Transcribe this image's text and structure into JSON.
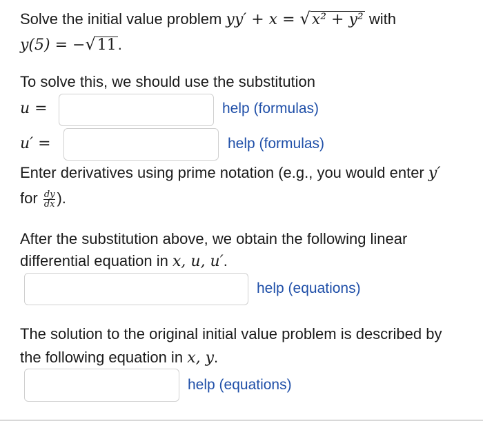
{
  "problem": {
    "intro": "Solve the initial value problem",
    "ode": "yy′ + x = ",
    "rad": "√",
    "radicand": "x² + y²",
    "with": "with",
    "ic_lhs": "y(5) = −",
    "ic_rad": "√",
    "ic_radicand": "11",
    "period": "."
  },
  "substitution": {
    "prompt": "To solve this, we should use the substitution",
    "u_label": "u =",
    "u_help": "help (formulas)",
    "uprime_label": "u′ =",
    "uprime_help": "help (formulas)",
    "note_a": "Enter derivatives using prime notation (e.g., you would enter",
    "note_y": "y′",
    "note_for": "for",
    "note_frac_num": "dy",
    "note_frac_den": "dx",
    "note_end": ")."
  },
  "linear": {
    "line1": "After the substitution above, we obtain the following linear",
    "line2": "differential equation in",
    "vars": "x, u, u′",
    "period": ".",
    "help": "help (equations)"
  },
  "solution": {
    "line1": "The solution to the original initial value problem is described by",
    "line2": "the following equation in",
    "vars": "x, y",
    "period": ".",
    "help": "help (equations)"
  },
  "inputs": {
    "u_value": "",
    "uprime_value": "",
    "linear_value": "",
    "solution_value": ""
  }
}
